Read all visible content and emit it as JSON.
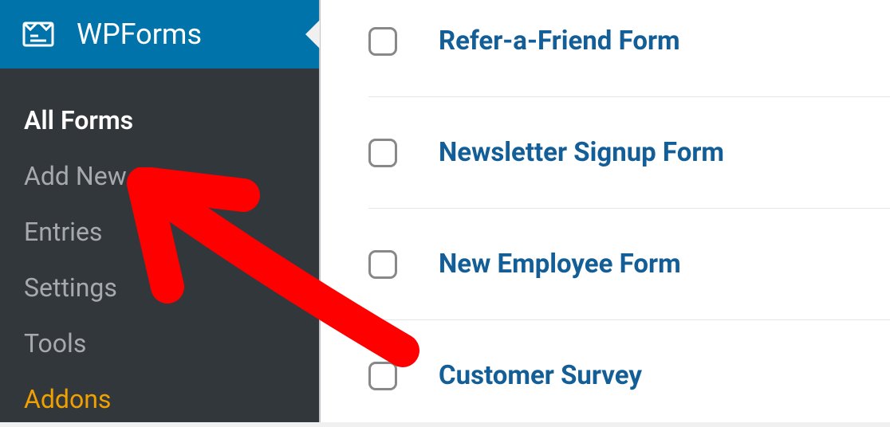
{
  "sidebar": {
    "active_label": "WPForms",
    "items": [
      {
        "label": "All Forms",
        "current": true
      },
      {
        "label": "Add New",
        "current": false
      },
      {
        "label": "Entries",
        "current": false
      },
      {
        "label": "Settings",
        "current": false
      },
      {
        "label": "Tools",
        "current": false
      },
      {
        "label": "Addons",
        "current": false,
        "highlight": true
      }
    ]
  },
  "forms": [
    {
      "title": "Refer-a-Friend Form"
    },
    {
      "title": "Newsletter Signup Form"
    },
    {
      "title": "New Employee Form"
    },
    {
      "title": "Customer Survey"
    }
  ]
}
